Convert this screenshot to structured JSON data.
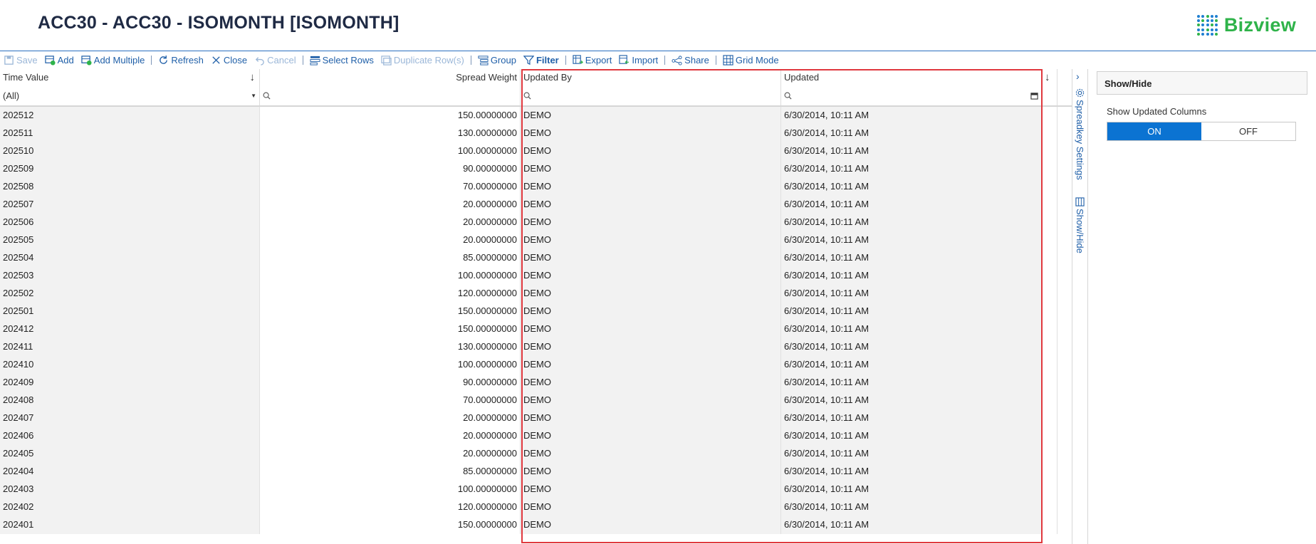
{
  "header": {
    "title": "ACC30 - ACC30 - ISOMONTH [ISOMONTH]",
    "brand": "Bizview"
  },
  "toolbar": {
    "save": "Save",
    "add": "Add",
    "add_multiple": "Add Multiple",
    "refresh": "Refresh",
    "close": "Close",
    "cancel": "Cancel",
    "select_rows": "Select Rows",
    "duplicate_rows": "Duplicate Row(s)",
    "group": "Group",
    "filter": "Filter",
    "export": "Export",
    "import": "Import",
    "share": "Share",
    "grid_mode": "Grid Mode"
  },
  "grid": {
    "columns": {
      "time_value": "Time Value",
      "spread_weight": "Spread Weight",
      "updated_by": "Updated By",
      "updated": "Updated"
    },
    "filter_time_value": "(All)",
    "rows": [
      [
        "202512",
        "150.00000000",
        "DEMO",
        "6/30/2014, 10:11 AM"
      ],
      [
        "202511",
        "130.00000000",
        "DEMO",
        "6/30/2014, 10:11 AM"
      ],
      [
        "202510",
        "100.00000000",
        "DEMO",
        "6/30/2014, 10:11 AM"
      ],
      [
        "202509",
        "90.00000000",
        "DEMO",
        "6/30/2014, 10:11 AM"
      ],
      [
        "202508",
        "70.00000000",
        "DEMO",
        "6/30/2014, 10:11 AM"
      ],
      [
        "202507",
        "20.00000000",
        "DEMO",
        "6/30/2014, 10:11 AM"
      ],
      [
        "202506",
        "20.00000000",
        "DEMO",
        "6/30/2014, 10:11 AM"
      ],
      [
        "202505",
        "20.00000000",
        "DEMO",
        "6/30/2014, 10:11 AM"
      ],
      [
        "202504",
        "85.00000000",
        "DEMO",
        "6/30/2014, 10:11 AM"
      ],
      [
        "202503",
        "100.00000000",
        "DEMO",
        "6/30/2014, 10:11 AM"
      ],
      [
        "202502",
        "120.00000000",
        "DEMO",
        "6/30/2014, 10:11 AM"
      ],
      [
        "202501",
        "150.00000000",
        "DEMO",
        "6/30/2014, 10:11 AM"
      ],
      [
        "202412",
        "150.00000000",
        "DEMO",
        "6/30/2014, 10:11 AM"
      ],
      [
        "202411",
        "130.00000000",
        "DEMO",
        "6/30/2014, 10:11 AM"
      ],
      [
        "202410",
        "100.00000000",
        "DEMO",
        "6/30/2014, 10:11 AM"
      ],
      [
        "202409",
        "90.00000000",
        "DEMO",
        "6/30/2014, 10:11 AM"
      ],
      [
        "202408",
        "70.00000000",
        "DEMO",
        "6/30/2014, 10:11 AM"
      ],
      [
        "202407",
        "20.00000000",
        "DEMO",
        "6/30/2014, 10:11 AM"
      ],
      [
        "202406",
        "20.00000000",
        "DEMO",
        "6/30/2014, 10:11 AM"
      ],
      [
        "202405",
        "20.00000000",
        "DEMO",
        "6/30/2014, 10:11 AM"
      ],
      [
        "202404",
        "85.00000000",
        "DEMO",
        "6/30/2014, 10:11 AM"
      ],
      [
        "202403",
        "100.00000000",
        "DEMO",
        "6/30/2014, 10:11 AM"
      ],
      [
        "202402",
        "120.00000000",
        "DEMO",
        "6/30/2014, 10:11 AM"
      ],
      [
        "202401",
        "150.00000000",
        "DEMO",
        "6/30/2014, 10:11 AM"
      ]
    ]
  },
  "vtabs": {
    "settings": "Spreadkey Settings",
    "showhide": "Show/Hide"
  },
  "side_panel": {
    "title": "Show/Hide",
    "label": "Show Updated Columns",
    "on": "ON",
    "off": "OFF"
  },
  "colors": {
    "accent": "#0b73d2",
    "brand_green": "#2fb34a",
    "highlight": "#e0383e"
  }
}
